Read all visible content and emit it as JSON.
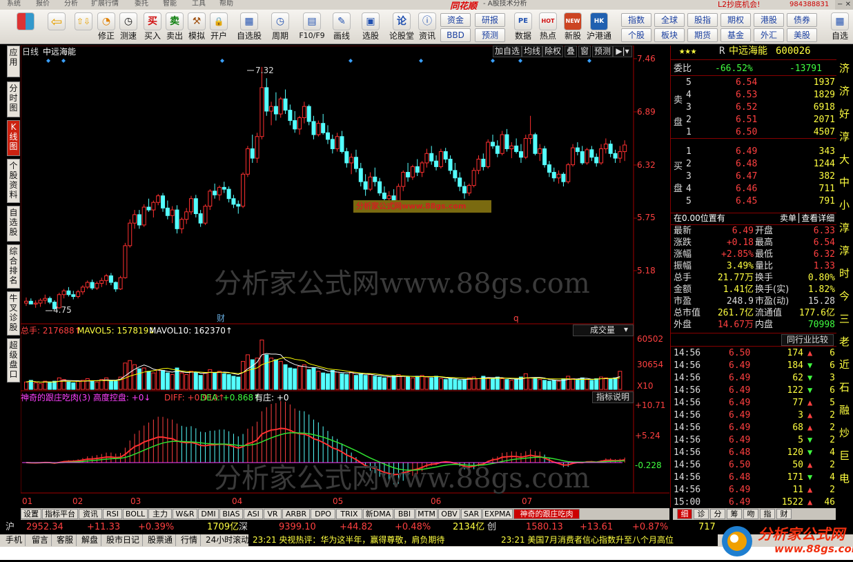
{
  "menu": {
    "items": [
      "系统",
      "报价",
      "分析",
      "扩展行情",
      "委托",
      "智能",
      "工具",
      "帮助"
    ],
    "brand": "同花顺",
    "subtitle": "- A股技术分析",
    "l2_promo": "L2抄底机会!",
    "account": "984388831",
    "window_controls": "−  ✕"
  },
  "toolbar": {
    "buttons": [
      {
        "icon": "⇦",
        "label": ""
      },
      {
        "icon": "⇧⇩",
        "label": ""
      },
      {
        "icon": "◔",
        "label": "修正"
      },
      {
        "icon": "◷",
        "label": "测速"
      },
      {
        "icon": "买",
        "label": "买入",
        "color": "#d01010"
      },
      {
        "icon": "卖",
        "label": "卖出",
        "color": "#108010"
      },
      {
        "icon": "⚒",
        "label": "模拟"
      },
      {
        "icon": "🔒",
        "label": "开户"
      },
      {
        "icon": "▦",
        "label": "自选股"
      },
      {
        "icon": "◷",
        "label": "周期"
      },
      {
        "icon": "▤",
        "label": "F10/F9"
      },
      {
        "icon": "✎",
        "label": "画线"
      },
      {
        "icon": "▣",
        "label": "选股"
      },
      {
        "icon": "论",
        "label": "论股堂"
      },
      {
        "icon": "ⓘ",
        "label": "资讯"
      }
    ],
    "grid_buttons_a": [
      "资金",
      "BBD",
      "研报",
      "预测"
    ],
    "buttons_b": [
      {
        "icon": "PE",
        "label": "数据"
      },
      {
        "icon": "HOT",
        "label": "热点"
      },
      {
        "icon": "NEW",
        "label": "新股"
      },
      {
        "icon": "HK",
        "label": "沪港通"
      }
    ],
    "grid_buttons_b": [
      "指数",
      "个股",
      "全球",
      "板块",
      "股指",
      "期货",
      "期权",
      "基金",
      "港股",
      "外汇",
      "债券",
      "美股"
    ],
    "last": "自选"
  },
  "leftnav": [
    {
      "label": "应用",
      "active": false
    },
    {
      "label": "分时图",
      "active": false
    },
    {
      "label": "K线图",
      "active": true
    },
    {
      "label": "个股资料",
      "active": false
    },
    {
      "label": "自选股",
      "active": false
    },
    {
      "label": "综合排名",
      "active": false
    },
    {
      "label": "牛叉诊股",
      "active": false
    },
    {
      "label": "超级盘口",
      "active": false
    }
  ],
  "chart": {
    "period": "日线",
    "stock_name": "中远海能",
    "top_buttons": [
      "加自选",
      "均线",
      "除权",
      "叠",
      "窗",
      "预测",
      "▶|▾"
    ],
    "price_ticks": [
      "7.46",
      "6.89",
      "6.32",
      "5.75",
      "5.18"
    ],
    "high_label": "7.32",
    "low_label": "4.75",
    "watermark_small": "分析家公式网www.88gs.com",
    "watermark": "分析家公式网www.88gs.com",
    "event_cai": "财",
    "event_q": "q",
    "volume": {
      "total_label": "总手: 217688↑",
      "ma5_label": "MAVOL5: 157819↓",
      "ma10_label": "MAVOL10: 162370↑",
      "select": "成交量",
      "ticks": [
        "60502",
        "30654",
        "X10"
      ]
    },
    "indicator": {
      "name_label": "神奇的跟庄吃肉(3) 高度控盘: +0↓",
      "diff_label": "DIFF: +0.910↑",
      "dea_label": "DEA: +0.868↑",
      "zhuang_label": "有庄: +0",
      "explain_button": "指标说明",
      "ticks": [
        "+10.71",
        "+5.24",
        "-0.228"
      ]
    },
    "months": [
      "01",
      "02",
      "03",
      "04",
      "05",
      "06",
      "07"
    ]
  },
  "chart_data": {
    "type": "candlestick",
    "ylim": [
      4.5,
      7.5
    ],
    "note_candles": "approximate daily candles read from the chart",
    "candles": [
      [
        4.81,
        4.87,
        4.78,
        4.83
      ],
      [
        4.83,
        4.86,
        4.8,
        4.8
      ],
      [
        4.8,
        4.84,
        4.76,
        4.81
      ],
      [
        4.81,
        4.86,
        4.77,
        4.84
      ],
      [
        4.84,
        4.9,
        4.8,
        4.86
      ],
      [
        4.86,
        4.88,
        4.8,
        4.82
      ],
      [
        4.82,
        4.84,
        4.74,
        4.75
      ],
      [
        4.76,
        4.92,
        4.75,
        4.9
      ],
      [
        4.9,
        4.96,
        4.86,
        4.94
      ],
      [
        4.94,
        4.98,
        4.88,
        4.9
      ],
      [
        4.9,
        4.94,
        4.85,
        4.88
      ],
      [
        4.88,
        4.95,
        4.86,
        4.93
      ],
      [
        4.93,
        5.0,
        4.9,
        4.98
      ],
      [
        4.98,
        5.05,
        4.96,
        5.03
      ],
      [
        5.03,
        5.06,
        4.95,
        4.97
      ],
      [
        4.97,
        5.04,
        4.95,
        5.02
      ],
      [
        5.02,
        5.08,
        4.98,
        5.05
      ],
      [
        5.05,
        5.12,
        5.0,
        5.1
      ],
      [
        5.1,
        5.13,
        5.0,
        5.03
      ],
      [
        5.03,
        5.04,
        4.93,
        4.96
      ],
      [
        4.96,
        5.1,
        4.95,
        5.08
      ],
      [
        5.08,
        5.45,
        5.07,
        5.42
      ],
      [
        5.42,
        5.7,
        5.4,
        5.66
      ],
      [
        5.66,
        5.8,
        5.6,
        5.75
      ],
      [
        5.75,
        5.8,
        5.6,
        5.64
      ],
      [
        5.64,
        5.86,
        5.62,
        5.83
      ],
      [
        5.83,
        5.92,
        5.78,
        5.8
      ],
      [
        5.8,
        5.9,
        5.72,
        5.88
      ],
      [
        5.88,
        5.97,
        5.85,
        5.95
      ],
      [
        5.95,
        5.98,
        5.78,
        5.82
      ],
      [
        5.82,
        5.9,
        5.7,
        5.74
      ],
      [
        5.74,
        5.84,
        5.66,
        5.8
      ],
      [
        5.8,
        5.85,
        5.55,
        5.6
      ],
      [
        5.6,
        5.72,
        5.55,
        5.7
      ],
      [
        5.7,
        5.82,
        5.65,
        5.78
      ],
      [
        5.78,
        5.95,
        5.75,
        5.92
      ],
      [
        5.92,
        5.96,
        5.72,
        5.76
      ],
      [
        5.76,
        5.8,
        5.62,
        5.66
      ],
      [
        5.66,
        5.86,
        5.64,
        5.84
      ],
      [
        5.84,
        6.02,
        5.8,
        6.0
      ],
      [
        6.0,
        6.08,
        5.92,
        5.96
      ],
      [
        5.96,
        6.06,
        5.9,
        6.04
      ],
      [
        6.04,
        6.1,
        5.98,
        6.02
      ],
      [
        6.02,
        6.05,
        5.88,
        5.92
      ],
      [
        5.92,
        5.96,
        5.82,
        5.86
      ],
      [
        5.86,
        5.9,
        5.76,
        5.84
      ],
      [
        5.84,
        6.2,
        5.82,
        6.18
      ],
      [
        6.18,
        6.48,
        6.15,
        6.45
      ],
      [
        6.45,
        6.6,
        6.3,
        6.35
      ],
      [
        6.35,
        6.62,
        6.3,
        6.58
      ],
      [
        6.58,
        7.32,
        6.55,
        7.1
      ],
      [
        7.1,
        7.2,
        6.8,
        6.85
      ],
      [
        6.85,
        6.95,
        6.7,
        6.9
      ],
      [
        6.9,
        7.05,
        6.75,
        6.82
      ],
      [
        6.82,
        7.0,
        6.78,
        6.98
      ],
      [
        6.98,
        7.08,
        6.82,
        6.86
      ],
      [
        6.86,
        6.92,
        6.7,
        6.75
      ],
      [
        6.75,
        6.85,
        6.62,
        6.66
      ],
      [
        6.66,
        6.8,
        6.6,
        6.78
      ],
      [
        6.78,
        6.95,
        6.72,
        6.9
      ],
      [
        6.9,
        6.92,
        6.7,
        6.74
      ],
      [
        6.74,
        6.8,
        6.55,
        6.6
      ],
      [
        6.6,
        6.75,
        6.58,
        6.72
      ],
      [
        6.72,
        6.82,
        6.6,
        6.62
      ],
      [
        6.62,
        6.7,
        6.5,
        6.55
      ],
      [
        6.55,
        6.6,
        6.4,
        6.45
      ],
      [
        6.45,
        6.62,
        6.42,
        6.58
      ],
      [
        6.58,
        6.64,
        6.4,
        6.42
      ],
      [
        6.42,
        6.46,
        6.25,
        6.3
      ],
      [
        6.3,
        6.4,
        6.18,
        6.36
      ],
      [
        6.36,
        6.44,
        6.2,
        6.24
      ],
      [
        6.24,
        6.3,
        6.05,
        6.1
      ],
      [
        6.1,
        6.18,
        5.95,
        6.02
      ],
      [
        6.02,
        6.2,
        6.0,
        6.15
      ],
      [
        6.15,
        6.25,
        6.05,
        6.1
      ],
      [
        6.1,
        6.14,
        5.95,
        5.98
      ],
      [
        5.98,
        6.05,
        5.85,
        5.92
      ],
      [
        5.92,
        6.0,
        5.82,
        5.95
      ],
      [
        5.95,
        6.02,
        5.88,
        5.9
      ],
      [
        5.9,
        6.08,
        5.86,
        6.05
      ],
      [
        6.05,
        6.22,
        6.0,
        6.2
      ],
      [
        6.2,
        6.3,
        6.1,
        6.15
      ],
      [
        6.15,
        6.28,
        6.12,
        6.26
      ],
      [
        6.26,
        6.34,
        6.16,
        6.2
      ],
      [
        6.2,
        6.32,
        6.15,
        6.3
      ],
      [
        6.3,
        6.45,
        6.25,
        6.4
      ],
      [
        6.4,
        6.48,
        6.28,
        6.32
      ],
      [
        6.32,
        6.38,
        6.22,
        6.26
      ],
      [
        6.26,
        6.45,
        6.24,
        6.42
      ],
      [
        6.42,
        6.46,
        6.3,
        6.34
      ],
      [
        6.34,
        6.38,
        6.18,
        6.22
      ],
      [
        6.22,
        6.3,
        6.1,
        6.14
      ],
      [
        6.14,
        6.2,
        6.0,
        6.05
      ],
      [
        6.05,
        6.1,
        5.92,
        5.98
      ],
      [
        5.98,
        6.08,
        5.95,
        6.06
      ],
      [
        6.06,
        6.25,
        6.04,
        6.22
      ],
      [
        6.22,
        6.38,
        6.18,
        6.34
      ],
      [
        6.34,
        6.4,
        6.22,
        6.26
      ],
      [
        6.26,
        6.55,
        6.24,
        6.52
      ],
      [
        6.52,
        6.6,
        6.45,
        6.48
      ],
      [
        6.48,
        6.54,
        6.36,
        6.4
      ],
      [
        6.4,
        6.64,
        6.38,
        6.6
      ],
      [
        6.6,
        6.66,
        6.42,
        6.45
      ],
      [
        6.45,
        6.52,
        6.35,
        6.48
      ],
      [
        6.48,
        6.56,
        6.4,
        6.42
      ],
      [
        6.42,
        6.5,
        6.3,
        6.36
      ],
      [
        6.36,
        6.6,
        6.34,
        6.56
      ],
      [
        6.56,
        6.8,
        6.5,
        6.6
      ],
      [
        6.6,
        6.62,
        6.38,
        6.4
      ],
      [
        6.4,
        6.5,
        6.32,
        6.45
      ],
      [
        6.45,
        6.48,
        6.25,
        6.28
      ],
      [
        6.28,
        6.32,
        6.15,
        6.2
      ],
      [
        6.2,
        6.25,
        6.1,
        6.14
      ],
      [
        6.14,
        6.22,
        6.08,
        6.18
      ],
      [
        6.18,
        6.2,
        6.05,
        6.1
      ],
      [
        6.1,
        6.3,
        6.08,
        6.28
      ],
      [
        6.28,
        6.5,
        6.26,
        6.46
      ],
      [
        6.46,
        6.52,
        6.38,
        6.42
      ],
      [
        6.42,
        6.48,
        6.28,
        6.3
      ],
      [
        6.3,
        6.46,
        6.28,
        6.44
      ],
      [
        6.44,
        6.48,
        6.32,
        6.36
      ],
      [
        6.36,
        6.4,
        6.26,
        6.3
      ],
      [
        6.3,
        6.5,
        6.28,
        6.45
      ],
      [
        6.45,
        6.56,
        6.4,
        6.5
      ],
      [
        6.5,
        6.54,
        6.36,
        6.4
      ],
      [
        6.4,
        6.44,
        6.3,
        6.35
      ],
      [
        6.35,
        6.48,
        6.3,
        6.42
      ],
      [
        6.42,
        6.54,
        6.32,
        6.49
      ]
    ],
    "volume": [
      0.9,
      1.1,
      0.8,
      0.7,
      1.0,
      0.9,
      1.0,
      1.4,
      1.2,
      0.9,
      0.8,
      1.0,
      1.1,
      1.3,
      1.0,
      0.9,
      1.2,
      1.4,
      1.1,
      1.0,
      1.5,
      3.2,
      3.5,
      3.0,
      2.5,
      2.6,
      2.2,
      2.0,
      2.4,
      2.3,
      2.0,
      1.8,
      2.6,
      2.0,
      1.8,
      2.2,
      2.1,
      1.7,
      2.0,
      2.4,
      2.0,
      2.2,
      1.9,
      1.8,
      1.6,
      1.5,
      3.4,
      4.2,
      3.6,
      3.8,
      6.0,
      4.2,
      3.8,
      3.6,
      3.4,
      3.0,
      2.6,
      2.5,
      2.8,
      3.0,
      2.4,
      2.6,
      2.2,
      2.0,
      1.9,
      2.3,
      2.1,
      1.9,
      1.8,
      2.1,
      1.7,
      1.9,
      1.7,
      1.8,
      1.6,
      1.5,
      1.4,
      1.5,
      1.6,
      1.8,
      1.6,
      1.5,
      1.4,
      1.6,
      1.7,
      1.5,
      1.4,
      1.6,
      1.3,
      1.2,
      1.3,
      1.2,
      1.1,
      1.2,
      1.4,
      1.5,
      1.3,
      1.6,
      1.4,
      1.3,
      1.5,
      1.3,
      1.2,
      1.1,
      1.2,
      1.5,
      1.9,
      1.4,
      1.3,
      1.2,
      1.1,
      1.0,
      1.1,
      1.0,
      1.3,
      1.6,
      1.3,
      1.2,
      1.4,
      1.2,
      1.1,
      1.3,
      1.5,
      1.4,
      1.3,
      1.4,
      2.2
    ]
  },
  "quote": {
    "stars": "★★★",
    "r": "R",
    "name": "中远海能",
    "code": "600026",
    "weibi_label": "委比",
    "weibi": "-66.52%",
    "weicha": "-13791",
    "sell_label": "卖盘",
    "buy_label": "买盘",
    "asks": [
      {
        "lvl": "5",
        "price": "6.54",
        "vol": "1937"
      },
      {
        "lvl": "4",
        "price": "6.53",
        "vol": "1829"
      },
      {
        "lvl": "3",
        "price": "6.52",
        "vol": "6918"
      },
      {
        "lvl": "2",
        "price": "6.51",
        "vol": "2071"
      },
      {
        "lvl": "1",
        "price": "6.50",
        "vol": "4507"
      }
    ],
    "bids": [
      {
        "lvl": "1",
        "price": "6.49",
        "vol": "343"
      },
      {
        "lvl": "2",
        "price": "6.48",
        "vol": "1244"
      },
      {
        "lvl": "3",
        "price": "6.47",
        "vol": "382"
      },
      {
        "lvl": "4",
        "price": "6.46",
        "vol": "711"
      },
      {
        "lvl": "5",
        "price": "6.45",
        "vol": "791"
      }
    ],
    "pos_note": "在0.00位置有",
    "detail_link": "卖单│查看详细",
    "stats": [
      {
        "k1": "最新",
        "v1": "6.49",
        "c1": "#ff4040",
        "k2": "开盘",
        "v2": "6.33",
        "c2": "#ff4040"
      },
      {
        "k1": "涨跌",
        "v1": "+0.18",
        "c1": "#ff4040",
        "k2": "最高",
        "v2": "6.54",
        "c2": "#ff4040"
      },
      {
        "k1": "涨幅",
        "v1": "+2.85%",
        "c1": "#ff4040",
        "k2": "最低",
        "v2": "6.32",
        "c2": "#ff4040"
      },
      {
        "k1": "振幅",
        "v1": "3.49%",
        "c1": "#ffff40",
        "k2": "量比",
        "v2": "1.33",
        "c2": "#ff4040"
      },
      {
        "k1": "总手",
        "v1": "21.77万",
        "c1": "#ffff40",
        "k2": "换手",
        "v2": "0.80%",
        "c2": "#ffff40"
      },
      {
        "k1": "金额",
        "v1": "1.41亿",
        "c1": "#ffff40",
        "k2": "换手(实)",
        "v2": "1.82%",
        "c2": "#ffff40"
      },
      {
        "k1": "市盈",
        "v1": "248.9",
        "c1": "#dddddd",
        "k2": "市盈(动)",
        "v2": "15.28",
        "c2": "#dddddd"
      },
      {
        "k1": "总市值",
        "v1": "261.7亿",
        "c1": "#ffff40",
        "k2": "流通值",
        "v2": "177.6亿",
        "c2": "#ffff40"
      },
      {
        "k1": "外盘",
        "v1": "14.67万",
        "c1": "#ff4040",
        "k2": "内盘",
        "v2": "70998",
        "c2": "#40ff40"
      }
    ],
    "compare_button": "同行业比较",
    "trades": [
      {
        "t": "14:56",
        "p": "6.50",
        "v": "174",
        "d": "up",
        "e": "6"
      },
      {
        "t": "14:56",
        "p": "6.49",
        "v": "184",
        "d": "down",
        "e": "6"
      },
      {
        "t": "14:56",
        "p": "6.49",
        "v": "62",
        "d": "down",
        "e": "3"
      },
      {
        "t": "14:56",
        "p": "6.49",
        "v": "122",
        "d": "down",
        "e": "6"
      },
      {
        "t": "14:56",
        "p": "6.49",
        "v": "77",
        "d": "up",
        "e": "5"
      },
      {
        "t": "14:56",
        "p": "6.49",
        "v": "3",
        "d": "up",
        "e": "2"
      },
      {
        "t": "14:56",
        "p": "6.49",
        "v": "68",
        "d": "up",
        "e": "2"
      },
      {
        "t": "14:56",
        "p": "6.49",
        "v": "5",
        "d": "down",
        "e": "2"
      },
      {
        "t": "14:56",
        "p": "6.48",
        "v": "120",
        "d": "down",
        "e": "4"
      },
      {
        "t": "14:56",
        "p": "6.50",
        "v": "50",
        "d": "up",
        "e": "2"
      },
      {
        "t": "14:56",
        "p": "6.48",
        "v": "171",
        "d": "down",
        "e": "4"
      },
      {
        "t": "14:56",
        "p": "6.49",
        "v": "11",
        "d": "up",
        "e": "2"
      },
      {
        "t": "15:00",
        "p": "6.49",
        "v": "1522",
        "d": "up",
        "e": "46"
      }
    ]
  },
  "far_right_text": [
    "济",
    "济",
    "好",
    "淳",
    "大",
    "中",
    "小",
    "淳",
    "淳",
    "时",
    "今",
    "三",
    "老",
    "近",
    "石",
    "融",
    "炒",
    "巨",
    "电"
  ],
  "bottom_tabs": [
    "设置",
    "指标平台",
    "资讯",
    "RSI",
    "BOLL",
    "主力",
    "W&R",
    "DMI",
    "BIAS",
    "ASI",
    "VR",
    "ARBR",
    "DPO",
    "TRIX",
    "新DMA",
    "BBI",
    "MTM",
    "OBV",
    "SAR",
    "EXPMA",
    "神奇的跟庄吃肉"
  ],
  "right_tabs": [
    "细",
    "诊",
    "分",
    "筹",
    "吻",
    "指",
    "财"
  ],
  "index_bar": {
    "sh_label": "沪",
    "sh_val": "2952.34",
    "sh_chg": "+11.33",
    "sh_pct": "+0.39%",
    "sh_amt": "1709亿",
    "sz_label": "深",
    "sz_val": "9399.10",
    "sz_chg": "+44.82",
    "sz_pct": "+0.48%",
    "sz_amt": "2134亿",
    "cy_label": "创",
    "cy_val": "1580.13",
    "cy_chg": "+13.61",
    "cy_pct": "+0.87%",
    "right": "717"
  },
  "status": {
    "items": [
      "手机",
      "留言",
      "客服",
      "解盘",
      "股市日记",
      "股票通",
      "行情",
      "24小时滚动"
    ],
    "news1": "23:21 央视热评：华为这半年，赢得尊敬，肩负期待",
    "news2": "23:21 美国7月消费者信心指数升至八个月高位"
  },
  "footer_logo": "分析家公式网",
  "footer_url": "www.88gs.com",
  "colors": {
    "up": "#ff3030",
    "down": "#54ffff",
    "frame": "#a00000",
    "ma5": "#ffffff",
    "ma10": "#ffff00"
  }
}
